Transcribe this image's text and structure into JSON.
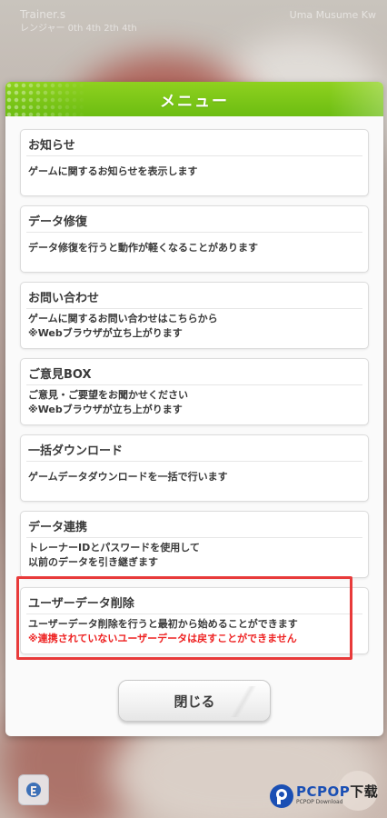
{
  "status_bar": {
    "left_line1": "Trainer.s",
    "left_line2": "レンジャー 0th 4th 2th 4th",
    "right": "Uma Musume Kw"
  },
  "dialog": {
    "title": "メニュー",
    "items": [
      {
        "title": "お知らせ",
        "desc": "ゲームに関するお知らせを表示します"
      },
      {
        "title": "データ修復",
        "desc": "データ修復を行うと動作が軽くなることがあります"
      },
      {
        "title": "お問い合わせ",
        "desc_line1": "ゲームに関するお問い合わせはこちらから",
        "desc_line2": "※Webブラウザが立ち上がります"
      },
      {
        "title": "ご意見BOX",
        "desc_line1": "ご意見・ご要望をお聞かせください",
        "desc_line2": "※Webブラウザが立ち上がります"
      },
      {
        "title": "一括ダウンロード",
        "desc": "ゲームデータダウンロードを一括で行います"
      },
      {
        "title": "データ連携",
        "desc_line1": "トレーナーIDとパスワードを使用して",
        "desc_line2": "以前のデータを引き継ぎます"
      },
      {
        "title": "ユーザーデータ削除",
        "desc_line1": "ユーザーデータ削除を行うと最初から始めることができます",
        "warning": "※連携されていないユーザーデータは戻すことができません"
      }
    ],
    "close_label": "閉じる"
  },
  "colors": {
    "header_green": "#7cc71a",
    "highlight_red": "#e83a3a",
    "warning_red": "#ee2222"
  },
  "watermark": {
    "main": "PCPOP",
    "download": "下载",
    "sub": "PCPOP Download"
  }
}
